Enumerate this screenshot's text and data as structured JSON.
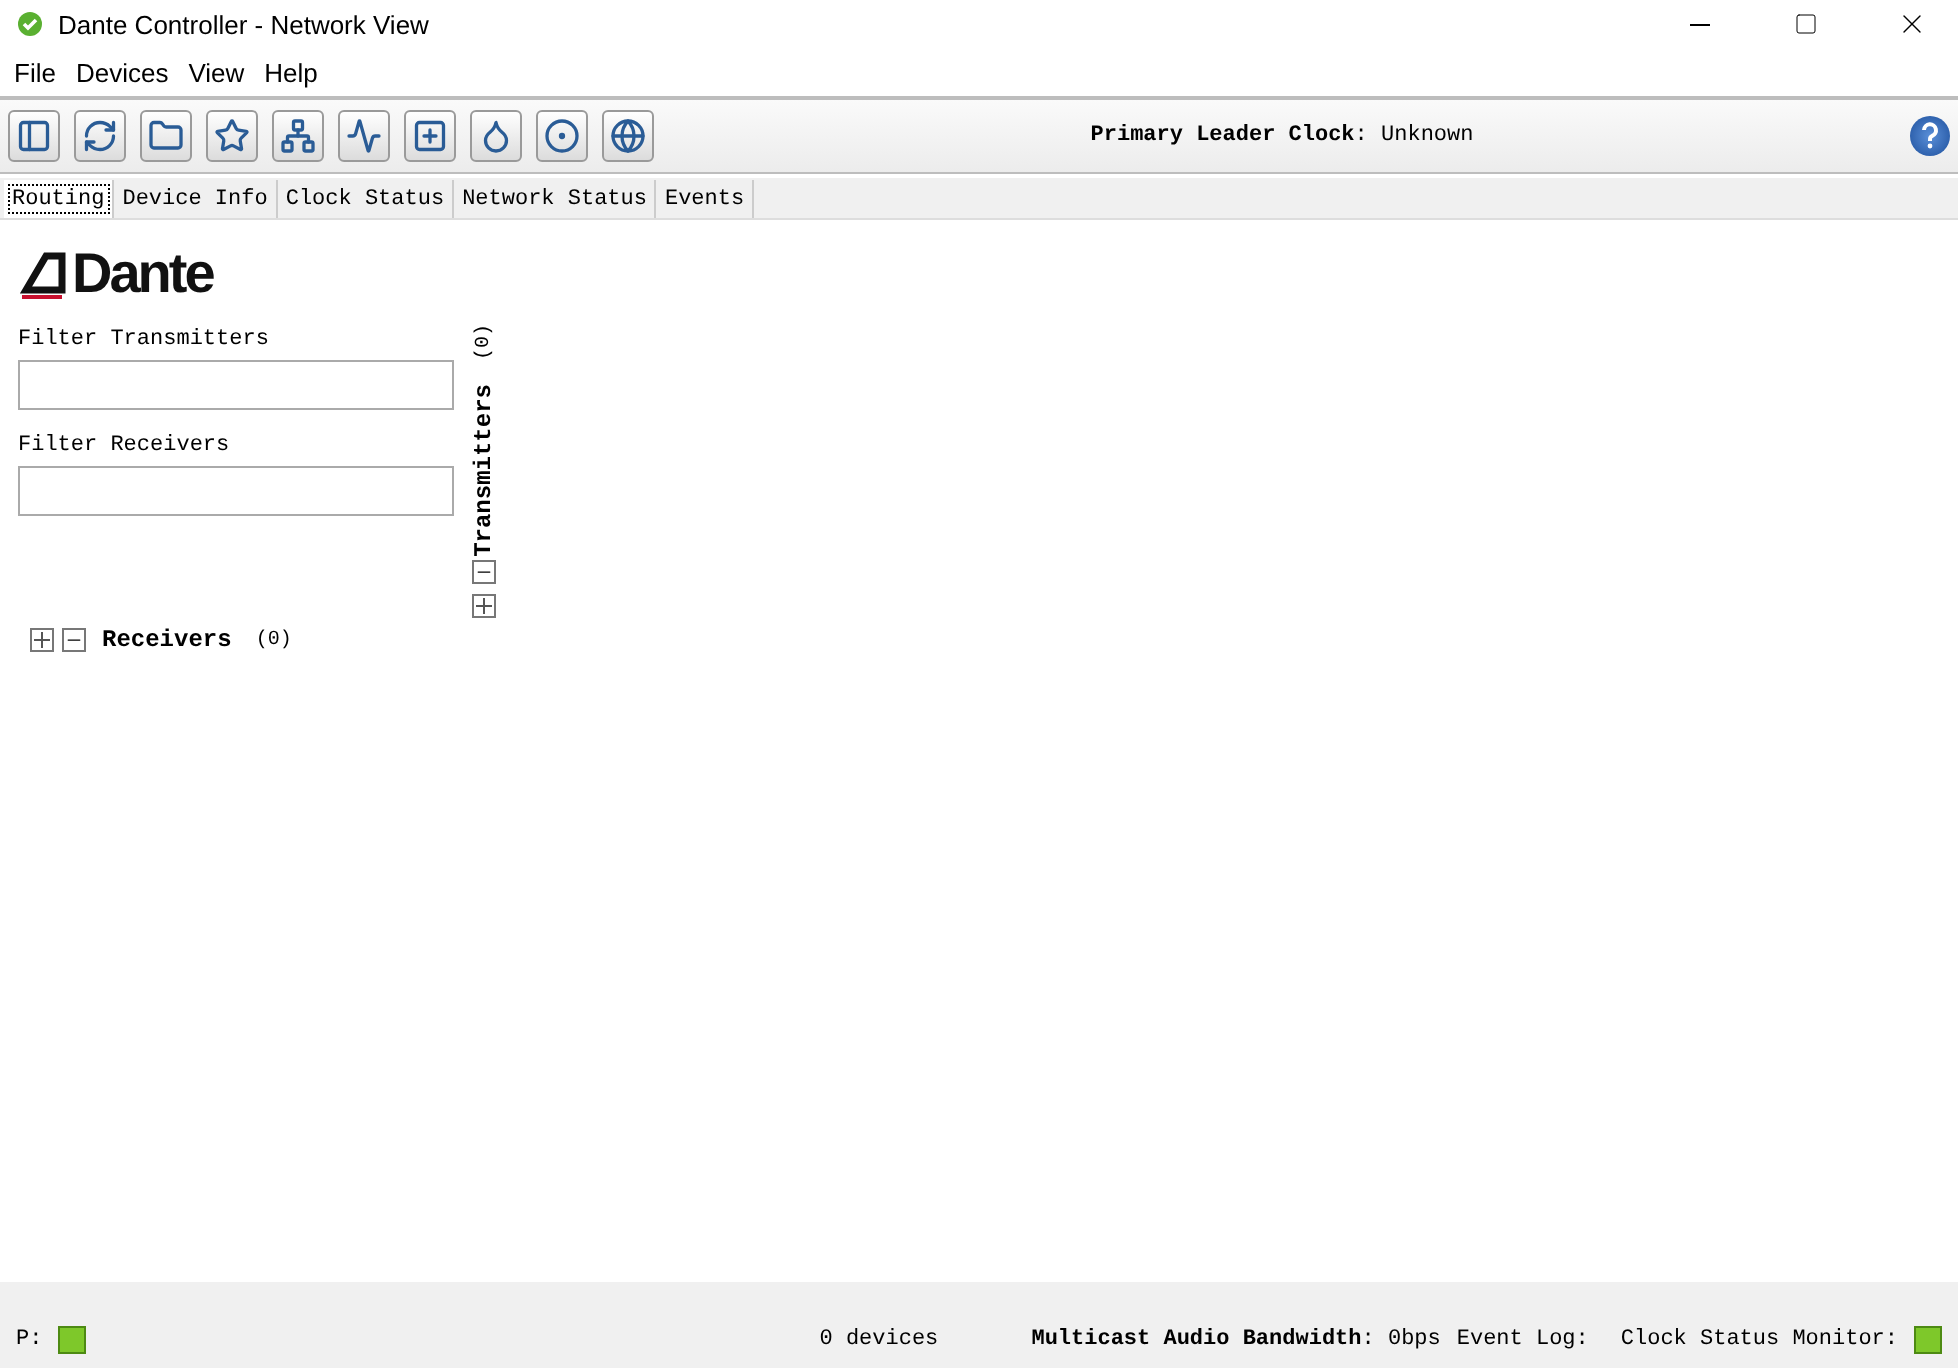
{
  "window": {
    "title": "Dante Controller - Network View"
  },
  "menu": [
    "File",
    "Devices",
    "View",
    "Help"
  ],
  "toolbar": {
    "buttons": [
      {
        "kind": "sidebar"
      },
      {
        "kind": "refresh"
      },
      {
        "kind": "folder"
      },
      {
        "kind": "star"
      },
      {
        "kind": "network"
      },
      {
        "kind": "monitor"
      },
      {
        "kind": "add"
      },
      {
        "kind": "drop"
      },
      {
        "kind": "ring"
      },
      {
        "kind": "globe"
      }
    ],
    "clock_label": "Primary Leader Clock",
    "clock_sep": ":",
    "clock_value": "Unknown"
  },
  "tabs": [
    {
      "label": "Routing",
      "selected": true
    },
    {
      "label": "Device Info",
      "selected": false
    },
    {
      "label": "Clock Status",
      "selected": false
    },
    {
      "label": "Network Status",
      "selected": false
    },
    {
      "label": "Events",
      "selected": false
    }
  ],
  "routing": {
    "logo": "Dante",
    "filter_transmitters": {
      "label": "Filter Transmitters"
    },
    "filter_receivers": {
      "label": "Filter Receivers"
    },
    "transmitters": {
      "label": "Transmitters",
      "count": "(0)"
    },
    "receivers": {
      "label": "Receivers",
      "count": "(0)"
    }
  },
  "status_bar": {
    "p_label": "P:",
    "devices": "0 devices",
    "bandwidth_label": "Multicast Audio Bandwidth",
    "bandwidth_sep": ":",
    "bandwidth_value": "0bps",
    "event_log": "Event Log:",
    "clock_monitor": "Clock Status Monitor:"
  }
}
